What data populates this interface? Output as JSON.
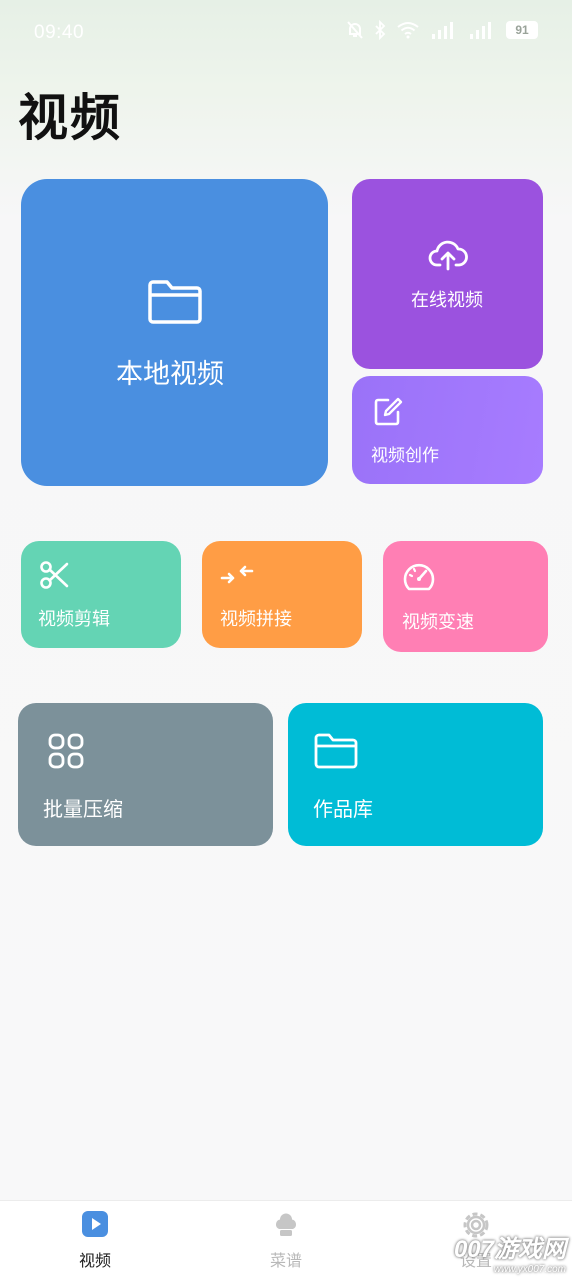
{
  "status_bar": {
    "time": "09:40",
    "battery": "91"
  },
  "page": {
    "title": "视频"
  },
  "tiles": {
    "local_video": "本地视频",
    "online_video": "在线视频",
    "video_create": "视频创作",
    "video_edit": "视频剪辑",
    "video_join": "视频拼接",
    "video_speed": "视频变速",
    "batch_compress": "批量压缩",
    "works_library": "作品库"
  },
  "tab_bar": {
    "items": [
      {
        "label": "视频",
        "icon": "play-icon",
        "active": true
      },
      {
        "label": "菜谱",
        "icon": "chef-hat-icon",
        "active": false
      },
      {
        "label": "设置",
        "icon": "gear-icon",
        "active": false
      }
    ]
  },
  "watermark": {
    "brand": "007游戏网",
    "url": "www.yx007.com"
  },
  "colors": {
    "local_video": "#4a8fe0",
    "online_video": "#9b52df",
    "video_create": "#a077fc",
    "video_edit": "#64d4b4",
    "video_join": "#ff9d45",
    "video_speed": "#ff7fb4",
    "batch_compress": "#7c919a",
    "works_library": "#00bcd6",
    "tab_active": "#4a8fe0",
    "tab_inactive": "#b8b8b8"
  }
}
